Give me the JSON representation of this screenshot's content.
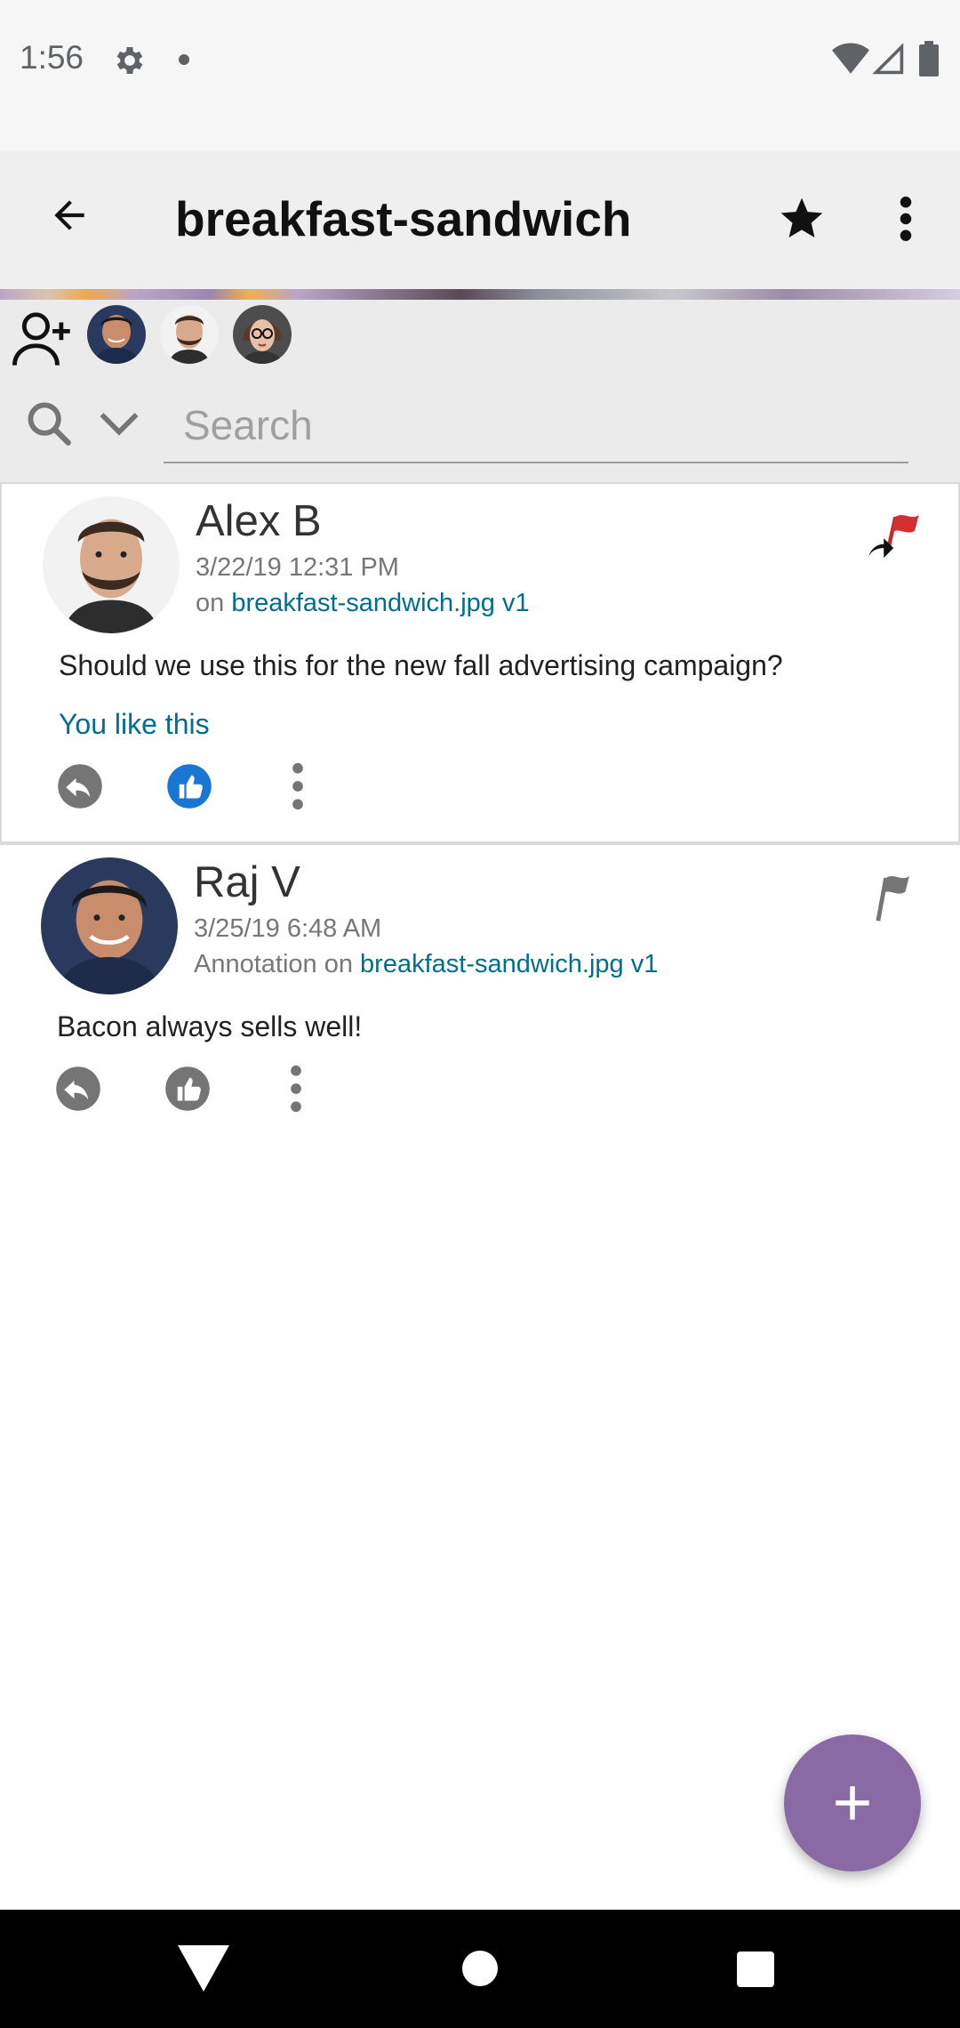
{
  "status_bar": {
    "time": "1:56",
    "icons": [
      "gear-icon",
      "dot-icon",
      "wifi-icon",
      "signal-icon",
      "battery-icon"
    ]
  },
  "app_bar": {
    "title": "breakfast-sandwich",
    "icons": [
      "back-arrow-icon",
      "star-icon",
      "more-vert-icon"
    ]
  },
  "collaborators": {
    "add_icon": "add-user-icon",
    "avatars": [
      "raj-avatar",
      "alex-avatar",
      "woman-glasses-avatar"
    ]
  },
  "search": {
    "placeholder": "Search",
    "value": ""
  },
  "comments": [
    {
      "author": "Alex B",
      "date": "3/22/19 12:31 PM",
      "meta_prefix": "on ",
      "file_link": "breakfast-sandwich.jpg v1",
      "text": "Should we use this for the new fall advertising campaign?",
      "like_status": "You like this",
      "liked": true,
      "flagged": true,
      "flag_color": "#d32f2f"
    },
    {
      "author": "Raj V",
      "date": "3/25/19 6:48 AM",
      "meta_prefix": "Annotation on ",
      "file_link": "breakfast-sandwich.jpg v1",
      "text": "Bacon always sells well!",
      "liked": false,
      "flagged": false,
      "flag_color": "#757575"
    }
  ],
  "fab": {
    "icon": "plus-icon"
  },
  "colors": {
    "accent": "#8a6aa5",
    "link": "#006e8f",
    "like_active": "#1976d2",
    "icon_gray": "#757575"
  }
}
